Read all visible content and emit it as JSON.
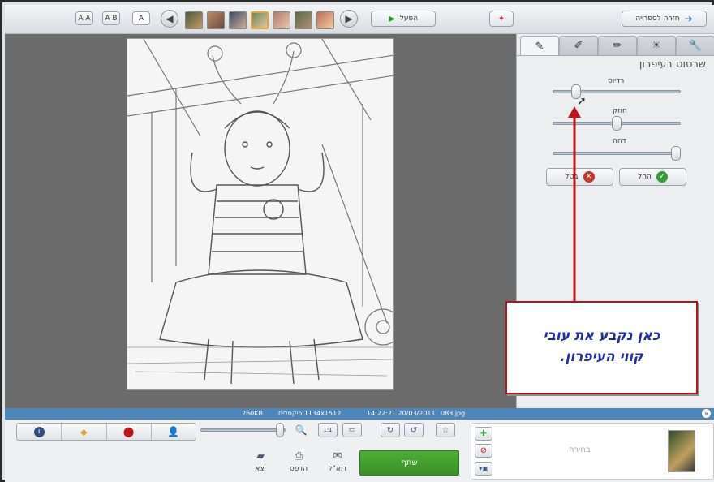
{
  "topbar": {
    "back_label": "חזרה לספרייה",
    "play_label": "הפעל",
    "font_buttons": [
      "A A",
      "A B",
      "A"
    ]
  },
  "panel": {
    "title": "שרטוט בעיפרון",
    "sliders": [
      {
        "label": "רדיוס",
        "value": 0.18
      },
      {
        "label": "חוזק",
        "value": 0.5
      },
      {
        "label": "דהה",
        "value": 0.95
      }
    ],
    "apply_label": "החל",
    "cancel_label": "בטל"
  },
  "callout": {
    "line1": "כאן נקבע את עובי",
    "line2": "קווי העיפרון."
  },
  "status": {
    "size": "260KB",
    "dimensions": "1134x1512 פיקסלים",
    "datetime": "14:22:21 20/03/2011",
    "filename": "083.jpg"
  },
  "bottom": {
    "share_label": "שתף",
    "email_label": "דוא\"ל",
    "print_label": "הדפס",
    "export_label": "יצא",
    "tray_placeholder": "בחירה",
    "zoom_value": 0.95,
    "fit_label": "1:1"
  },
  "colors": {
    "accent_blue": "#4f86ba",
    "share_green": "#44a02f",
    "callout_red": "#b5141a",
    "callout_text": "#1d2fa8"
  }
}
